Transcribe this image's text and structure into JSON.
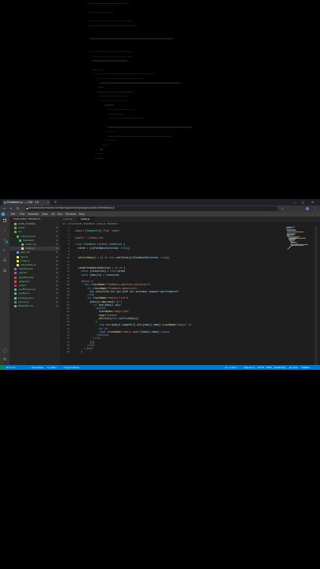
{
  "browser": {
    "tab_title": "Feedback.js — C30 · CS",
    "new_tab": "+",
    "url": "localhost/theme/serviceworkspace/src/playground/src/Feedback.js",
    "window_controls": [
      "—",
      "▢",
      "✕"
    ],
    "nav": [
      "←",
      "→",
      "↻"
    ],
    "addr_right": [
      "☆",
      "⋮"
    ]
  },
  "vscode": {
    "menu": [
      "File",
      "Edit",
      "Selection",
      "View",
      "Go",
      "Run",
      "Terminal",
      "Help"
    ],
    "activity": [
      "files-icon",
      "search-icon",
      "source-control-icon",
      "run-icon",
      "extensions-icon",
      "remote-icon"
    ],
    "activity_bottom": [
      "account-icon",
      "gear-icon"
    ],
    "sidebar_title": "EXPLORER: FEEDBACK...",
    "tree": [
      {
        "name": "node_modules",
        "badge": "",
        "indent": 1,
        "color": "#c09553",
        "folder": true
      },
      {
        "name": "public",
        "badge": "U",
        "indent": 1,
        "color": "#4caf50",
        "folder": true
      },
      {
        "name": "src",
        "badge": "U",
        "indent": 1,
        "color": "#4caf50",
        "folder": true
      },
      {
        "name": "components",
        "badge": "U",
        "indent": 2,
        "color": "#4caf50",
        "folder": true
      },
      {
        "name": "Feedback",
        "badge": "U",
        "indent": 3,
        "color": "#4caf50",
        "folder": true
      },
      {
        "name": "index.css",
        "badge": "U",
        "indent": 4,
        "color": "#42a5f5",
        "folder": false
      },
      {
        "name": "index.js",
        "badge": "U",
        "indent": 4,
        "color": "#f1e05a",
        "folder": false,
        "selected": true
      },
      {
        "name": "App.css",
        "badge": "U",
        "indent": 2,
        "color": "#42a5f5",
        "folder": false
      },
      {
        "name": "App.js",
        "badge": "U",
        "indent": 2,
        "color": "#f1e05a",
        "folder": false
      },
      {
        "name": "index.js",
        "badge": "U",
        "indent": 2,
        "color": "#f1e05a",
        "folder": false
      },
      {
        "name": "setupTests.js",
        "badge": "U",
        "indent": 2,
        "color": "#f1e05a",
        "folder": false
      },
      {
        "name": ".eslintignore",
        "badge": "U",
        "indent": 1,
        "color": "#8a63d2",
        "folder": false
      },
      {
        "name": ".eslintrc",
        "badge": "U",
        "indent": 1,
        "color": "#8a63d2",
        "folder": false
      },
      {
        "name": ".gitattributes",
        "badge": "U",
        "indent": 1,
        "color": "#e44d26",
        "folder": false
      },
      {
        "name": ".gitignore",
        "badge": "U",
        "indent": 1,
        "color": "#e44d26",
        "folder": false
      },
      {
        "name": ".npmrc",
        "badge": "U",
        "indent": 1,
        "color": "#cb3837",
        "folder": false
      },
      {
        "name": ".prettierignore",
        "badge": "U",
        "indent": 1,
        "color": "#56b3b4",
        "folder": false
      },
      {
        "name": ".prettierrc",
        "badge": "U",
        "indent": 1,
        "color": "#56b3b4",
        "folder": false
      },
      {
        "name": "package.json",
        "badge": "U",
        "indent": 1,
        "color": "#8bc34a",
        "folder": false
      },
      {
        "name": "yarn.lock",
        "badge": "U",
        "indent": 1,
        "color": "#2c8ebb",
        "folder": false
      },
      {
        "name": "README.md",
        "badge": "U",
        "indent": 1,
        "color": "#42a5f5",
        "folder": false
      }
    ],
    "editor_tabs": [
      "index.js"
    ],
    "breadcrumb": "src › components › Feedback › index.js › Feedback",
    "code_lines": [
      {
        "n": "1",
        "t": ""
      },
      {
        "n": "2",
        "t": "import {Component} from 'react'"
      },
      {
        "n": "3",
        "t": ""
      },
      {
        "n": "4",
        "t": "import './index.css'"
      },
      {
        "n": "5",
        "t": ""
      },
      {
        "n": "6",
        "t": "class Feedback extends Component {"
      },
      {
        "n": "7",
        "t": "  state = {isFeedbackSelected: false}"
      },
      {
        "n": "8",
        "t": ""
      },
      {
        "n": "9",
        "t": ""
      },
      {
        "n": "10",
        "t": "  onClickEmoji = () => this.setState({isFeedbackSelected: true})"
      },
      {
        "n": "11",
        "t": ""
      },
      {
        "n": "12",
        "t": ""
      },
      {
        "n": "13",
        "t": "  renderFeedbackQuestion = () => {"
      },
      {
        "n": "14",
        "t": "    const {resources} = this.props"
      },
      {
        "n": "15",
        "t": "    const {emojis} = resources"
      },
      {
        "n": "16",
        "t": ""
      },
      {
        "n": "17",
        "t": "    return ("
      },
      {
        "n": "18",
        "t": "      <div className=\"feedback-question-container\">"
      },
      {
        "n": "19",
        "t": "        <h1 className=\"feedback-question\">"
      },
      {
        "n": "20",
        "t": "          How satisfied are you with our customer support performance?"
      },
      {
        "n": "21",
        "t": "        </h1>"
      },
      {
        "n": "22",
        "t": "        <ul className=\"emojis-list\">"
      },
      {
        "n": "23",
        "t": "          {emojis.map(emoji => ("
      },
      {
        "n": "24",
        "t": "            <li key={emoji.id}>"
      },
      {
        "n": "25",
        "t": "              <button"
      },
      {
        "n": "26",
        "t": "                className=\"emoji-btn\""
      },
      {
        "n": "27",
        "t": "                type=\"button\""
      },
      {
        "n": "28",
        "t": "                onClick={this.onClickEmoji}"
      },
      {
        "n": "29",
        "t": "              >"
      },
      {
        "n": "30",
        "t": "                <img src={emoji.imageUrl} alt={emoji.name} className=\"emoji\" />"
      },
      {
        "n": "31",
        "t": "                <br />"
      },
      {
        "n": "32",
        "t": "                <span className=\"emoji-name\">{emoji.name}</span>"
      },
      {
        "n": "33",
        "t": "              </button>"
      },
      {
        "n": "34",
        "t": "            </li>"
      },
      {
        "n": "35",
        "t": "          ))}"
      },
      {
        "n": "36",
        "t": "        </ul>"
      },
      {
        "n": "37",
        "t": "      </div>"
      },
      {
        "n": "38",
        "t": "    )"
      }
    ],
    "status_left": [
      "⊗ 0 ⚠ 0",
      "Live Share",
      "↻ main*",
      "↑ Synchronize"
    ],
    "status_right": [
      "Ln 1, Col 1",
      "Spaces: 2",
      "UTF-8",
      "CRLF",
      "JavaScript",
      "Go Live",
      "Prettier"
    ],
    "colors": {
      "keyword": "#c586c0",
      "storage": "#569cd6",
      "string": "#ce9178",
      "entity": "#4ec9b0",
      "function": "#dcdcaa",
      "variable": "#9cdcfe",
      "tag": "#569cd6",
      "attr": "#9cdcfe",
      "status_blue": "#007acc"
    }
  }
}
